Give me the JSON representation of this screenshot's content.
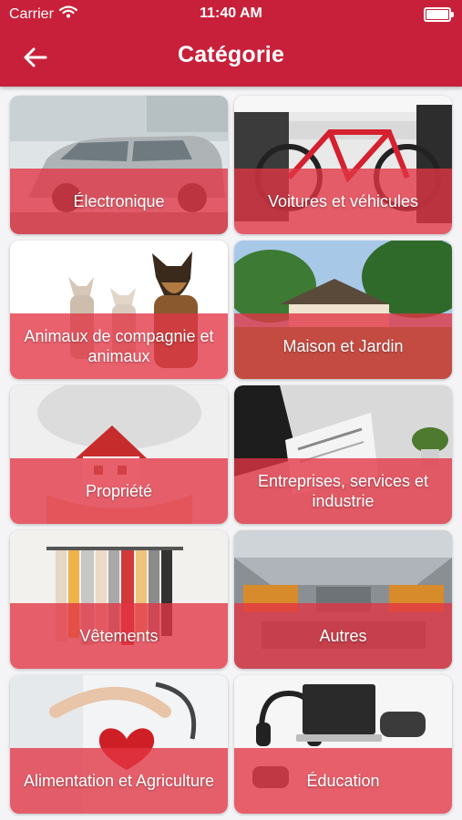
{
  "status_bar": {
    "carrier": "Carrier",
    "time": "11:40 AM",
    "icons": [
      "wifi-icon",
      "battery-icon"
    ]
  },
  "header": {
    "title": "Catégorie",
    "back_icon": "arrow-left-icon"
  },
  "colors": {
    "header": "#c8203a",
    "overlay": "#e23444",
    "background": "#f4f4f6"
  },
  "categories": [
    {
      "label": "Électronique",
      "image": "car-photo"
    },
    {
      "label": "Voitures et véhicules",
      "image": "bicycle-shop-photo"
    },
    {
      "label": "Animaux de compagnie et animaux",
      "image": "cats-and-dog-photo"
    },
    {
      "label": "Maison et Jardin",
      "image": "house-and-garden-photo"
    },
    {
      "label": "Propriété",
      "image": "house-in-hands-photo"
    },
    {
      "label": "Entreprises, services et industrie",
      "image": "business-newspaper-photo"
    },
    {
      "label": "Vêtements",
      "image": "clothes-rack-photo"
    },
    {
      "label": "Autres",
      "image": "factory-photo"
    },
    {
      "label": "Alimentation et Agriculture",
      "image": "heart-and-stethoscope-photo"
    },
    {
      "label": "Éducation",
      "image": "electronics-devices-photo"
    }
  ]
}
